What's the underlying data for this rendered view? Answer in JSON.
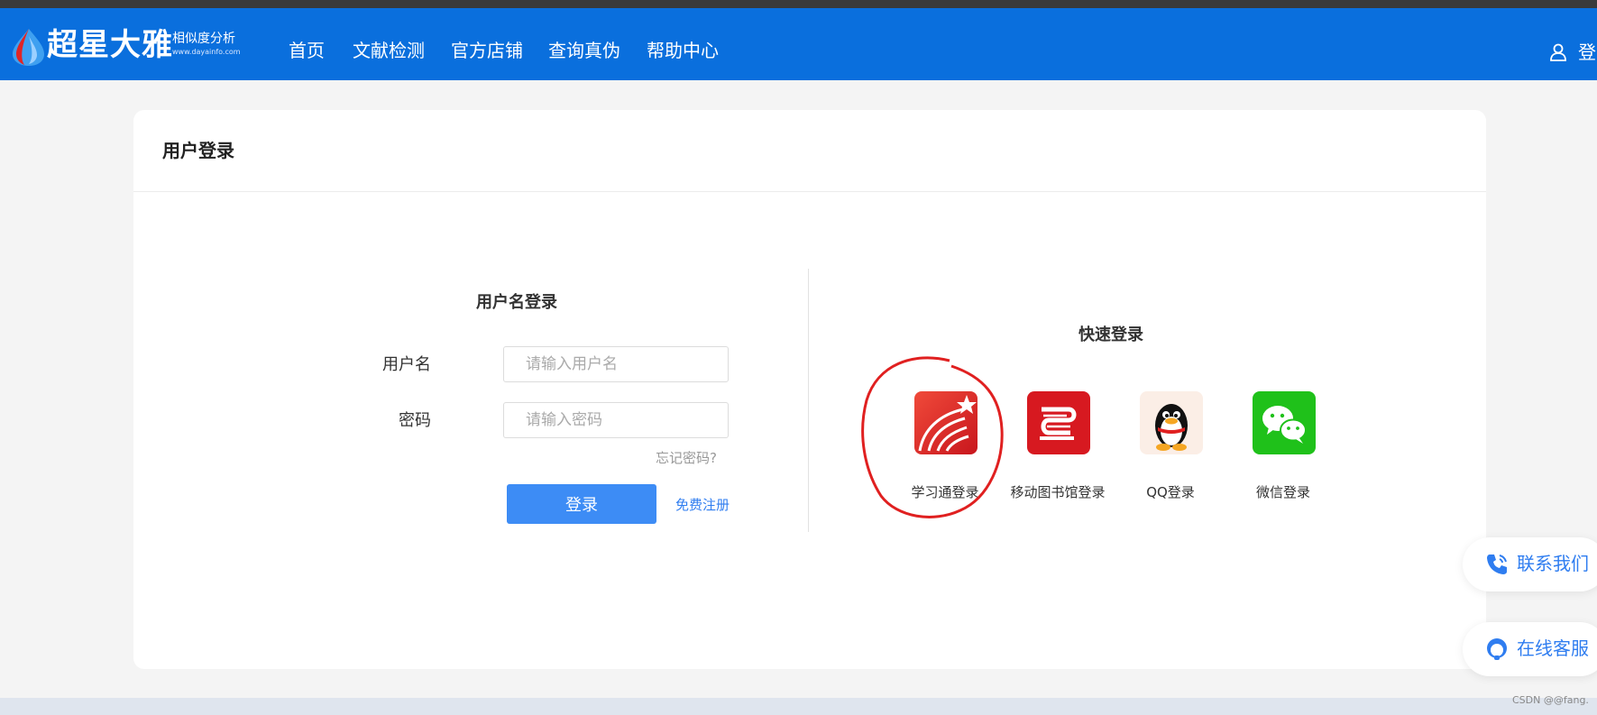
{
  "header": {
    "logo_name": "超星大雅",
    "logo_sub": "相似度分析",
    "logo_url": "www.dayainfo.com",
    "nav": [
      "首页",
      "文献检测",
      "官方店铺",
      "查询真伪",
      "帮助中心"
    ],
    "login": "登录"
  },
  "card": {
    "title": "用户登录"
  },
  "account_login": {
    "title": "用户名登录",
    "username_label": "用户名",
    "username_placeholder": "请输入用户名",
    "password_label": "密码",
    "password_placeholder": "请输入密码",
    "forgot": "忘记密码?",
    "submit": "登录",
    "register": "免费注册"
  },
  "quick_login": {
    "title": "快速登录",
    "items": [
      {
        "label": "学习通登录",
        "icon": "xuexitong-icon",
        "color": "#e3302b"
      },
      {
        "label": "移动图书馆登录",
        "icon": "mobile-library-icon",
        "color": "#d71920"
      },
      {
        "label": "QQ登录",
        "icon": "qq-penguin-icon",
        "color": "#fbeee6"
      },
      {
        "label": "微信登录",
        "icon": "wechat-icon",
        "color": "#1fc11a"
      }
    ]
  },
  "floating": {
    "contact": "联系我们",
    "service": "在线客服"
  },
  "watermark": "CSDN @@fang.",
  "colors": {
    "nav_bg": "#0a6fdd",
    "button": "#3d8cf5",
    "link": "#2f7df0",
    "annotation": "#e02020"
  }
}
